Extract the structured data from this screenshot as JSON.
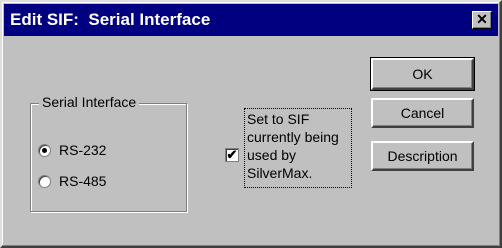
{
  "window": {
    "title": "Edit SIF:  Serial Interface",
    "close_glyph": "✕"
  },
  "buttons": {
    "ok": "OK",
    "cancel": "Cancel",
    "description": "Description"
  },
  "serial_interface": {
    "group_label": "Serial Interface",
    "options": [
      {
        "label": "RS-232",
        "selected": true
      },
      {
        "label": "RS-485",
        "selected": false
      }
    ]
  },
  "current_checkbox": {
    "checked": true,
    "check_glyph": "✔",
    "label": "Set to SIF currently being used by SilverMax."
  }
}
